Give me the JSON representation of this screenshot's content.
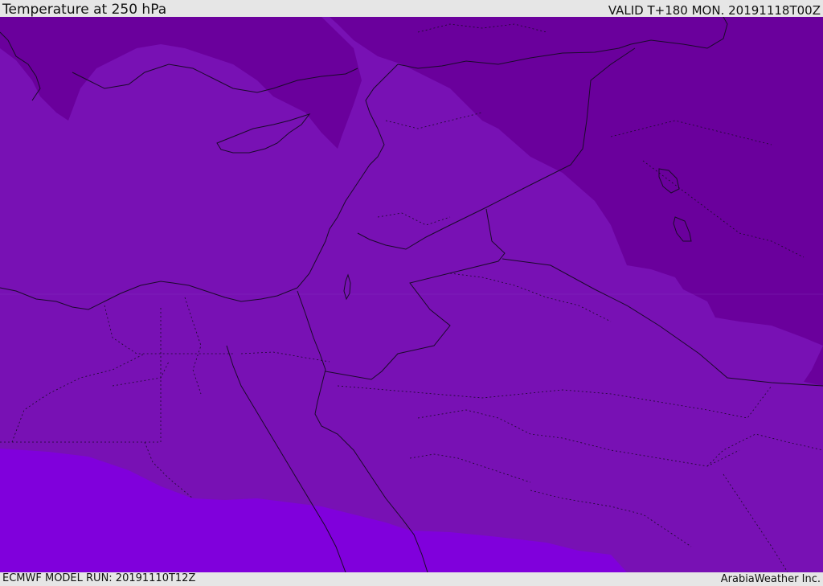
{
  "header": {
    "title": "Temperature at 250 hPa",
    "valid": "VALID T+180 MON. 20191118T00Z"
  },
  "footer": {
    "model_run": "ECMWF MODEL RUN: 20191110T12Z",
    "credit": "ArabiaWeather Inc."
  },
  "map": {
    "colors": {
      "cold_band": "#6a009c",
      "mid_band": "#7811b4",
      "warm_band": "#8000dc",
      "coastline": "#1a0a2a",
      "border": "#1a0a2a"
    }
  }
}
